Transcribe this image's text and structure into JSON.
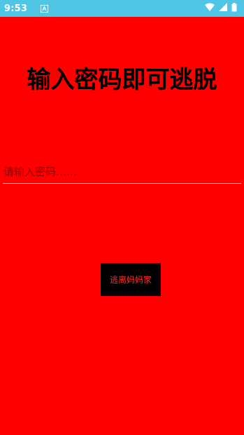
{
  "status_bar": {
    "time": "9:53",
    "notification_icon": "a-letter-notification-icon",
    "wifi_icon": "wifi-icon",
    "signal_icon": "cell-signal-icon",
    "battery_icon": "battery-icon"
  },
  "main": {
    "title": "输入密码即可逃脱",
    "password_placeholder": "请输入密码……",
    "password_value": "",
    "escape_button_label": "逃离妈妈家"
  },
  "colors": {
    "background": "#ff0000",
    "status_bar": "#4fc6e6",
    "button_bg": "#000000",
    "button_text": "#ff2a2a"
  }
}
